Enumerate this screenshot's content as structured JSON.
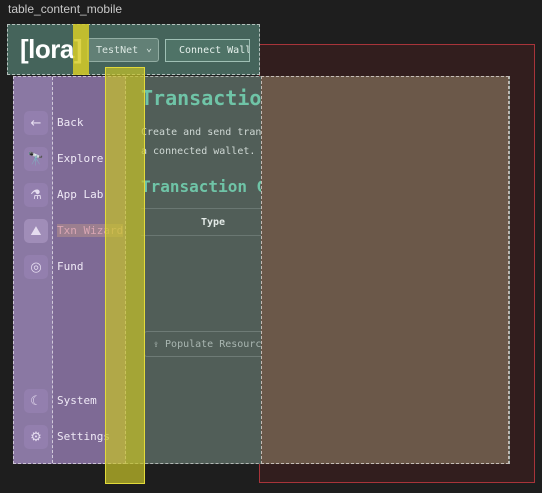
{
  "story_label": "table_content_mobile",
  "header": {
    "logo": "[lora]",
    "network_select": "TestNet",
    "connect_button": "Connect Walle"
  },
  "sidebar": {
    "items": [
      {
        "label": "Back",
        "icon": "arrow-left-icon",
        "glyph": "←"
      },
      {
        "label": "Explore",
        "icon": "telescope-icon",
        "glyph": "🔭"
      },
      {
        "label": "App Lab",
        "icon": "flask-icon",
        "glyph": "⚗"
      },
      {
        "label": "Txn Wizard",
        "icon": "wizard-hat-icon",
        "glyph": "⛰",
        "active": true
      },
      {
        "label": "Fund",
        "icon": "coins-icon",
        "glyph": "◎"
      }
    ],
    "bottom_items": [
      {
        "label": "System",
        "icon": "moon-icon",
        "glyph": "☾"
      },
      {
        "label": "Settings",
        "icon": "gear-icon",
        "glyph": "⚙"
      }
    ]
  },
  "main": {
    "title": "Transaction Wizard",
    "description_line1": "Create and send transactions using",
    "description_line2": "a connected wallet.",
    "section_title": "Transaction Group",
    "table_column": "Type",
    "populate_button": "Populate Resources"
  },
  "colors": {
    "accent": "#6fc4a7",
    "sidebar": "#7e6a95",
    "highlight": "#d7cd28"
  }
}
